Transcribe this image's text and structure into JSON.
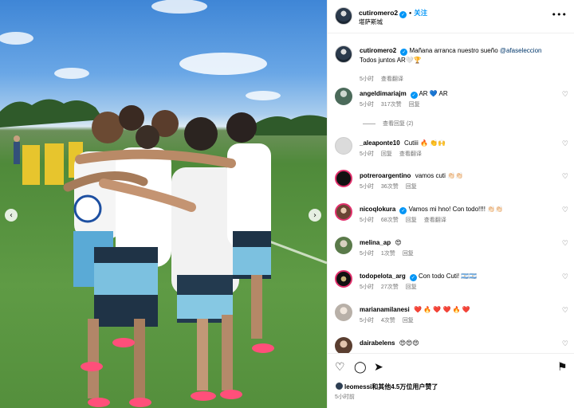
{
  "header": {
    "username": "cutiromero2",
    "separator": "•",
    "follow_label": "关注",
    "location": "堪萨斯城",
    "more_icon": "more-horizontal-icon"
  },
  "caption": {
    "username": "cutiromero2",
    "text": "Mañana arranca nuestro sueño",
    "mention": "@afaseleccion",
    "text2": "Todos juntos AR🤍🏆",
    "time": "5小时",
    "translate": "查看翻译"
  },
  "comments": [
    {
      "username": "angeldimariajm",
      "text": "AR 💙 AR",
      "time": "5小时",
      "likes": "317次赞",
      "reply": "回复",
      "view_replies": "查看回复 (2)"
    },
    {
      "username": "_aleaponte10",
      "text": "Cutiii 🔥 👏🙌",
      "time": "5小时",
      "reply": "回复",
      "translate": "查看翻译"
    },
    {
      "username": "potreroargentino",
      "text": "vamos cuti 👏🏻👏🏻",
      "time": "5小时",
      "likes": "36次赞",
      "reply": "回复"
    },
    {
      "username": "nicoqlokura",
      "text": "Vamos mi hno! Con todo!!!! 👏🏻👏🏻",
      "time": "5小时",
      "likes": "68次赞",
      "reply": "回复",
      "translate": "查看翻译"
    },
    {
      "username": "melina_ap",
      "text": "😍",
      "time": "5小时",
      "likes": "1次赞",
      "reply": "回复"
    },
    {
      "username": "todopelota_arg",
      "text": "Con todo Cuti! 🇦🇷🇦🇷",
      "time": "5小时",
      "likes": "27次赞",
      "reply": "回复"
    },
    {
      "username": "marianamilanesi",
      "text": "❤️ 🔥 ❤️ ❤️ 🔥 ❤️",
      "time": "5小时",
      "likes": "4次赞",
      "reply": "回复"
    },
    {
      "username": "dairabelens",
      "text": "😍😍😍",
      "time": "",
      "reply": ""
    }
  ],
  "actions": {
    "like_icon": "heart-icon",
    "comment_icon": "comment-icon",
    "share_icon": "share-icon",
    "save_icon": "bookmark-icon",
    "likes_text_user": "leomessi",
    "likes_text_rest": "和其他4.5万位用户赞了",
    "time_ago": "5小时前"
  },
  "colors": {
    "accent": "#0095f6",
    "muted": "#737373",
    "mention": "#00376b"
  }
}
